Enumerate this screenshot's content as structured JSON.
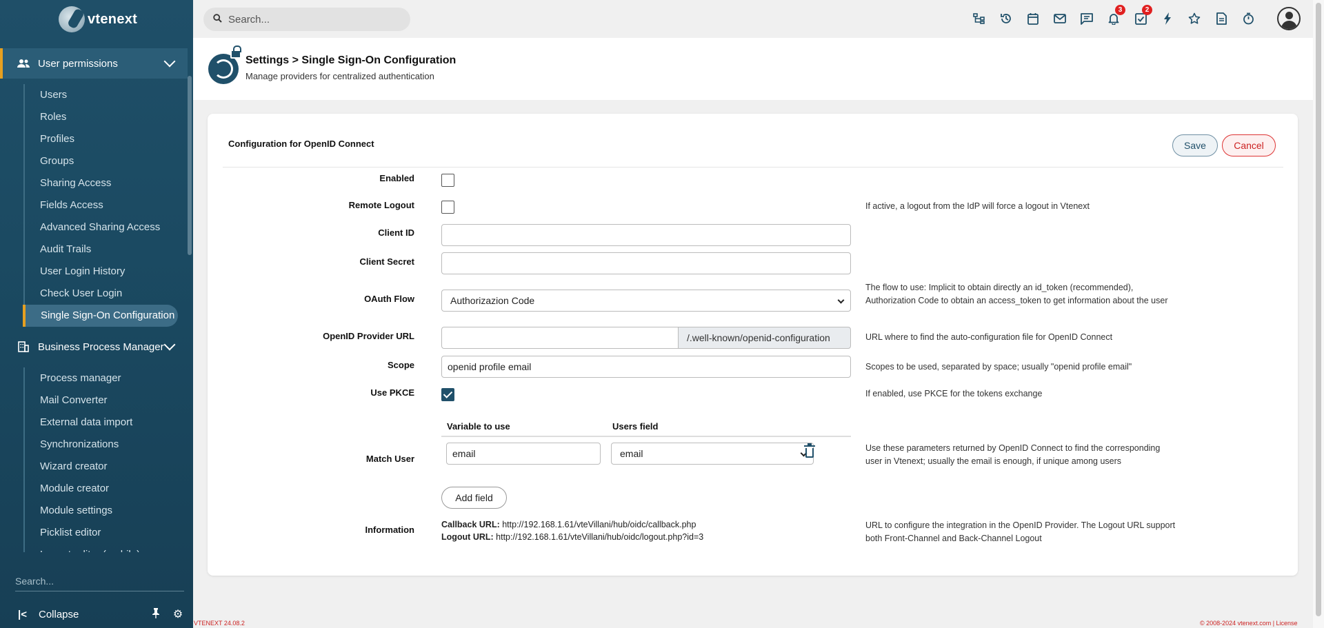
{
  "brand": {
    "name": "vtenext"
  },
  "sidebar": {
    "section1": {
      "label": "User permissions",
      "icon": "users-icon"
    },
    "section1_items": [
      {
        "label": "Users"
      },
      {
        "label": "Roles"
      },
      {
        "label": "Profiles"
      },
      {
        "label": "Groups"
      },
      {
        "label": "Sharing Access"
      },
      {
        "label": "Fields Access"
      },
      {
        "label": "Advanced Sharing Access"
      },
      {
        "label": "Audit Trails"
      },
      {
        "label": "User Login History"
      },
      {
        "label": "Check User Login"
      },
      {
        "label": "Single Sign-On Configuration",
        "active": true
      }
    ],
    "section2": {
      "label": "Business Process Manager",
      "icon": "building-icon"
    },
    "section2_items": [
      {
        "label": "Process manager"
      },
      {
        "label": "Mail Converter"
      },
      {
        "label": "External data import"
      },
      {
        "label": "Synchronizations"
      },
      {
        "label": "Wizard creator"
      },
      {
        "label": "Module creator"
      },
      {
        "label": "Module settings"
      },
      {
        "label": "Picklist editor"
      },
      {
        "label": "Layout editor (mobile)"
      }
    ],
    "search_placeholder": "Search...",
    "collapse_label": "Collapse"
  },
  "topbar": {
    "search_placeholder": "Search...",
    "icons": [
      {
        "name": "hierarchy-icon"
      },
      {
        "name": "history-icon"
      },
      {
        "name": "calendar-icon"
      },
      {
        "name": "mail-icon"
      },
      {
        "name": "chat-icon"
      },
      {
        "name": "bell-icon",
        "badge": "3"
      },
      {
        "name": "tasks-icon",
        "badge": "2"
      },
      {
        "name": "lightning-icon"
      },
      {
        "name": "star-icon"
      },
      {
        "name": "document-icon"
      },
      {
        "name": "timer-icon"
      }
    ]
  },
  "page_header": {
    "title": "Settings > Single Sign-On Configuration",
    "subtitle": "Manage providers for centralized authentication"
  },
  "card": {
    "title": "Configuration for OpenID Connect",
    "save_label": "Save",
    "cancel_label": "Cancel"
  },
  "form": {
    "enabled": {
      "label": "Enabled",
      "checked": false
    },
    "remote_logout": {
      "label": "Remote Logout",
      "checked": false,
      "help": "If active, a logout from the IdP will force a logout in Vtenext"
    },
    "client_id": {
      "label": "Client ID",
      "value": ""
    },
    "client_secret": {
      "label": "Client Secret",
      "value": ""
    },
    "oauth_flow": {
      "label": "OAuth Flow",
      "value": "Authorizazion Code",
      "help": "The flow to use: Implicit to obtain directly an id_token (recommended), Authorization Code to obtain an access_token to get information about the user"
    },
    "provider_url": {
      "label": "OpenID Provider URL",
      "value": "",
      "suffix": "/.well-known/openid-configuration",
      "help": "URL where to find the auto-configuration file for OpenID Connect"
    },
    "scope": {
      "label": "Scope",
      "value": "openid profile email",
      "help": "Scopes to be used, separated by space; usually \"openid profile email\""
    },
    "use_pkce": {
      "label": "Use PKCE",
      "checked": true,
      "help": "If enabled, use PKCE for the tokens exchange"
    },
    "match_user": {
      "label": "Match User",
      "col_variable": "Variable to use",
      "col_users_field": "Users field",
      "variable_value": "email",
      "users_field_value": "email",
      "add_field_label": "Add field",
      "help": "Use these parameters returned by OpenID Connect to find the corresponding user in Vtenext; usually the email is enough, if unique among users"
    },
    "information": {
      "label": "Information",
      "callback_label": "Callback URL:",
      "callback_url": "http://192.168.1.61/vteVillani/hub/oidc/callback.php",
      "logout_label": "Logout URL:",
      "logout_url": "http://192.168.1.61/vteVillani/hub/oidc/logout.php?id=3",
      "help": "URL to configure the integration in the OpenID Provider. The Logout URL support both Front-Channel and Back-Channel Logout"
    }
  },
  "footer": {
    "version": "VTENEXT 24.08.2",
    "copyright": "© 2008-2024 vtenext.com | License"
  }
}
